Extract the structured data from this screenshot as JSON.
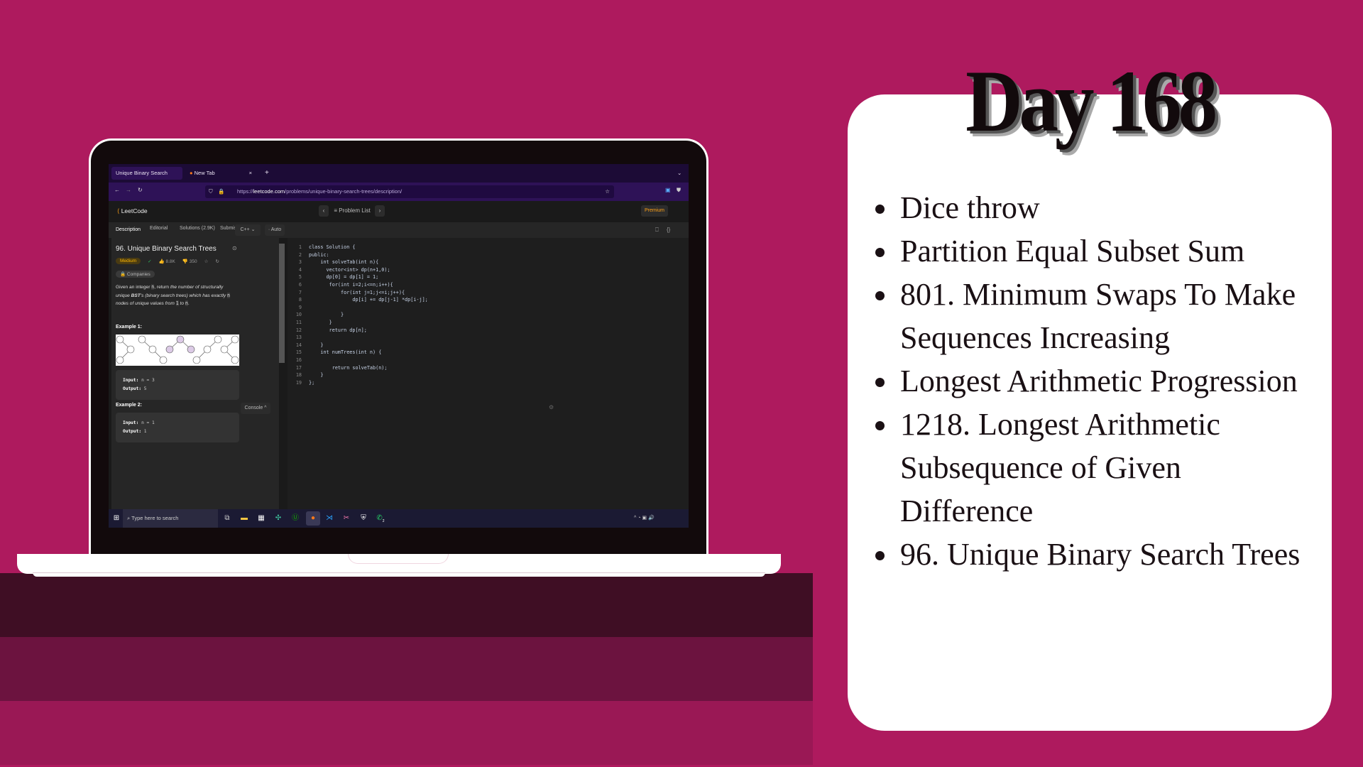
{
  "slide": {
    "title": "Day 168",
    "topics": [
      "Dice throw",
      "Partition Equal Subset Sum",
      "801. Minimum Swaps To Make Sequences Increasing",
      "Longest Arithmetic Progression",
      "1218. Longest Arithmetic Subsequence of Given Difference",
      "96. Unique Binary Search Trees"
    ],
    "colors": {
      "background": "#ae1a5e",
      "band1": "#3f0e24",
      "band2": "#6c133f",
      "band3": "#9a1855",
      "card": "#ffffff"
    }
  },
  "browser": {
    "tabs": [
      {
        "label": "Unique Binary Search Trees - Le",
        "close": "×"
      },
      {
        "label": "New Tab",
        "close": "×"
      }
    ],
    "new_tab": "+",
    "url_prefix": "https://",
    "url_domain": "leetcode.com",
    "url_path": "/problems/unique-binary-search-trees/description/"
  },
  "leetcode": {
    "logo": "LeetCode",
    "problem_list": "Problem List",
    "premium": "Premium",
    "tabs": [
      "Description",
      "Editorial",
      "Solutions (2.9K)",
      "Submissions"
    ],
    "language": "C++",
    "auto": "Auto",
    "problem": {
      "title": "96. Unique Binary Search Trees",
      "difficulty": "Medium",
      "likes": "8.8K",
      "dislikes": "350",
      "companies": "Companies",
      "desc_1": "Given an integer ",
      "desc_n": "n",
      "desc_2": ", return ",
      "desc_3": "the number of structurally unique ",
      "desc_bst": "BST",
      "desc_4": "'s (binary search trees) which has exactly ",
      "desc_5": " nodes of unique values from ",
      "desc_one": "1",
      "desc_to": " to ",
      "desc_end": ".",
      "example1_label": "Example 1:",
      "example1_input_label": "Input:",
      "example1_input": " n = 3",
      "example1_output_label": "Output:",
      "example1_output": " 5",
      "example2_label": "Example 2:",
      "example2_input_label": "Input:",
      "example2_input": " n = 1",
      "example2_output_label": "Output:",
      "example2_output": " 1"
    },
    "code": [
      "class Solution {",
      "public:",
      "    int solveTab(int n){",
      "      vector<int> dp(n+1,0);",
      "      dp[0] = dp[1] = 1;",
      "       for(int i=2;i<=n;i++){",
      "           for(int j=1;j<=i;j++){",
      "               dp[i] += dp[j-1] *dp[i-j];",
      "",
      "           }",
      "       }",
      "       return dp[n];",
      "",
      "    }",
      "    int numTrees(int n) {",
      "",
      "        return solveTab(n);",
      "    }",
      "};"
    ],
    "console": "Console ^"
  },
  "taskbar": {
    "search_placeholder": "Type here to search",
    "whatsapp_badge": "2"
  }
}
